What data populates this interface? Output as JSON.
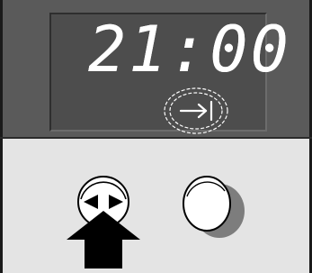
{
  "display": {
    "time": "21:00",
    "indicator": "end-time-icon",
    "indicator_state": "flashing"
  },
  "controls": {
    "select_button": {
      "icon": "left-right-arrows-icon"
    },
    "set_button": {
      "icon": "round-button"
    },
    "pointer": {
      "icon": "up-arrow-icon",
      "target": "select_button"
    }
  },
  "colors": {
    "panel_dark": "#5a5a5a",
    "display_bg": "#4d4d4d",
    "digits": "#ffffff",
    "panel_light": "#e4e4e4"
  }
}
